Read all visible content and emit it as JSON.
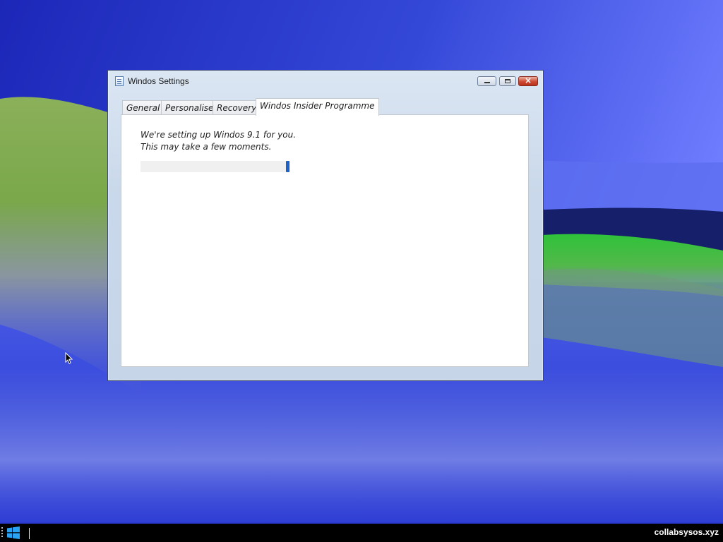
{
  "window": {
    "title": "Windos Settings",
    "close_glyph": "×",
    "accent_color": "#1c62c8"
  },
  "tabs": [
    {
      "label": "General",
      "active": false
    },
    {
      "label": "Personalise",
      "active": false
    },
    {
      "label": "Recovery",
      "active": false
    },
    {
      "label": "Windos Insider Programme",
      "active": true
    }
  ],
  "panel": {
    "message_line1": "We're setting up Windos 9.1 for you.",
    "message_line2": "This may take a few moments.",
    "progress_state": "indeterminate",
    "progress_indicator_color": "#1c62c8"
  },
  "taskbar": {
    "start_icon": "windows-logo-icon",
    "brand_label": "collabsysos.xyz"
  }
}
